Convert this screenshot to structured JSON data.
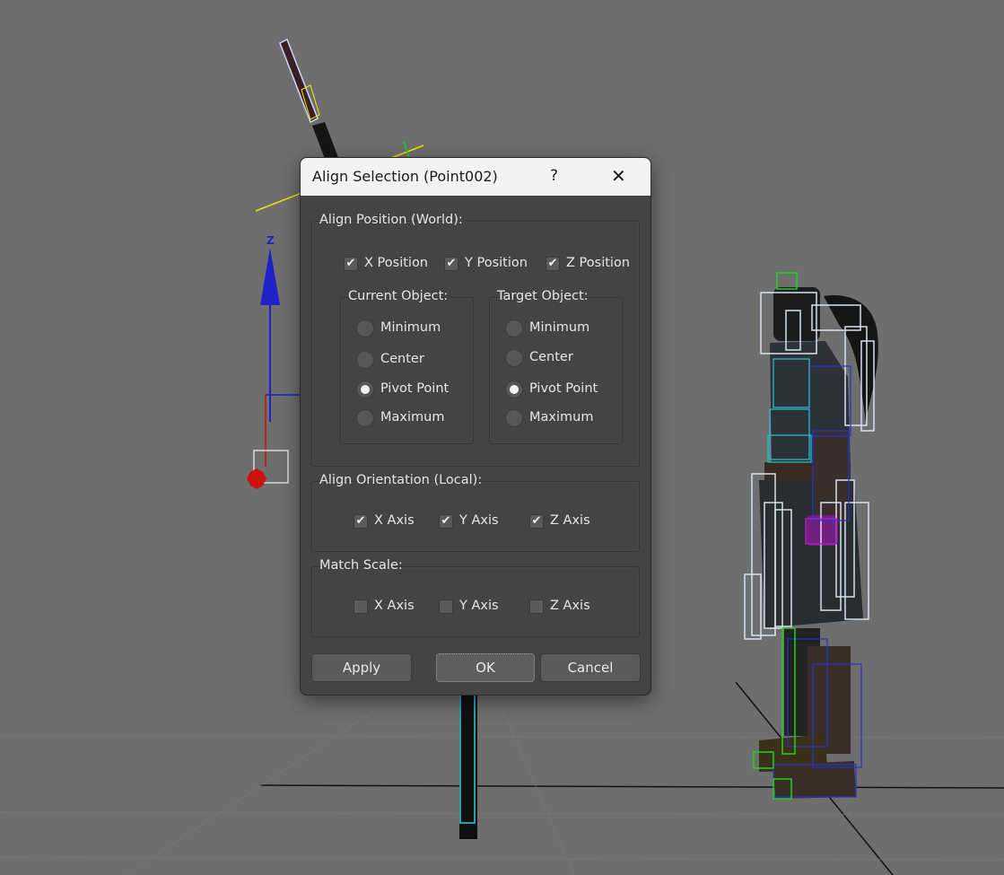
{
  "dialog": {
    "title": "Align Selection (Point002)",
    "help_glyph": "?",
    "close_glyph": "✕",
    "align_position": {
      "label": "Align Position (World):",
      "x_position": {
        "label": "X Position",
        "checked": true
      },
      "y_position": {
        "label": "Y Position",
        "checked": true
      },
      "z_position": {
        "label": "Z Position",
        "checked": true
      },
      "current_object": {
        "label": "Current Object:",
        "options": [
          "Minimum",
          "Center",
          "Pivot Point",
          "Maximum"
        ],
        "selected": "Pivot Point"
      },
      "target_object": {
        "label": "Target Object:",
        "options": [
          "Minimum",
          "Center",
          "Pivot Point",
          "Maximum"
        ],
        "selected": "Pivot Point"
      }
    },
    "align_orientation": {
      "label": "Align Orientation (Local):",
      "x_axis": {
        "label": "X Axis",
        "checked": true
      },
      "y_axis": {
        "label": "Y Axis",
        "checked": true
      },
      "z_axis": {
        "label": "Z Axis",
        "checked": true
      }
    },
    "match_scale": {
      "label": "Match Scale:",
      "x_axis": {
        "label": "X Axis",
        "checked": false
      },
      "y_axis": {
        "label": "Y Axis",
        "checked": false
      },
      "z_axis": {
        "label": "Z Axis",
        "checked": false
      }
    },
    "buttons": {
      "apply": "Apply",
      "ok": "OK",
      "cancel": "Cancel"
    },
    "check_glyph": "✔"
  },
  "viewport": {
    "gizmo_axis_label": "Z",
    "colors": {
      "background": "#6e6e6e",
      "axis_blue": "#1f22c8",
      "axis_red": "#cc1111",
      "axis_yellow": "#e6e600",
      "axis_green": "#1ed11e"
    }
  }
}
